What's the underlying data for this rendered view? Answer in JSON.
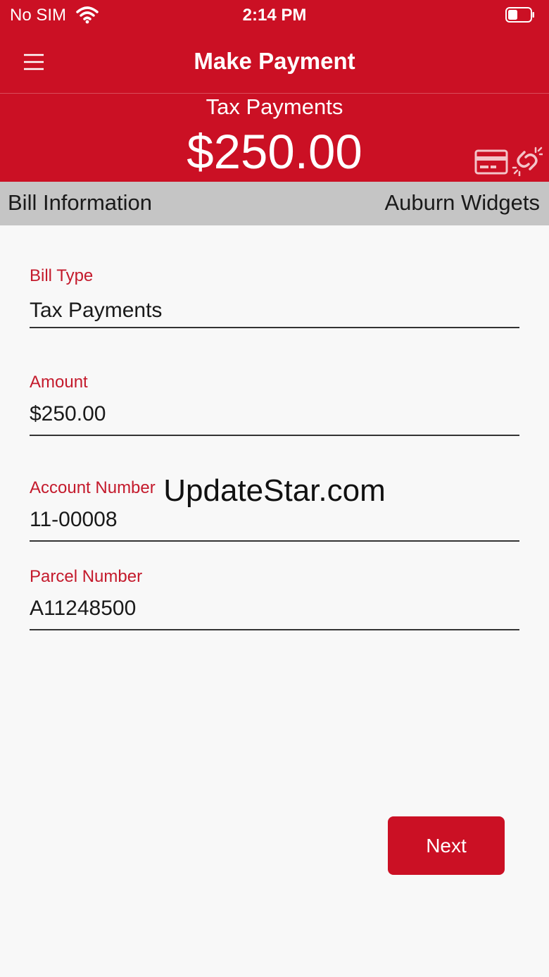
{
  "status_bar": {
    "carrier": "No SIM",
    "time": "2:14 PM",
    "icons": [
      "wifi-icon",
      "battery-icon"
    ]
  },
  "nav": {
    "title": "Make Payment",
    "menu_icon": "hamburger-menu-icon"
  },
  "summary": {
    "bill_type": "Tax Payments",
    "amount": "$250.00",
    "icons": [
      "credit-card-icon",
      "unlink-icon"
    ]
  },
  "section": {
    "title": "Bill Information",
    "merchant": "Auburn Widgets"
  },
  "fields": [
    {
      "label": "Bill Type",
      "value": "Tax Payments"
    },
    {
      "label": "Amount",
      "value": "$250.00"
    },
    {
      "label": "Account Number",
      "value": "11-00008"
    },
    {
      "label": "Parcel Number",
      "value": "A11248500"
    }
  ],
  "actions": {
    "next_label": "Next"
  },
  "watermark": "UpdateStar.com",
  "colors": {
    "brand_red": "#cb1024",
    "label_red": "#c41a2c",
    "section_gray": "#c5c5c5",
    "background": "#f8f8f8"
  }
}
